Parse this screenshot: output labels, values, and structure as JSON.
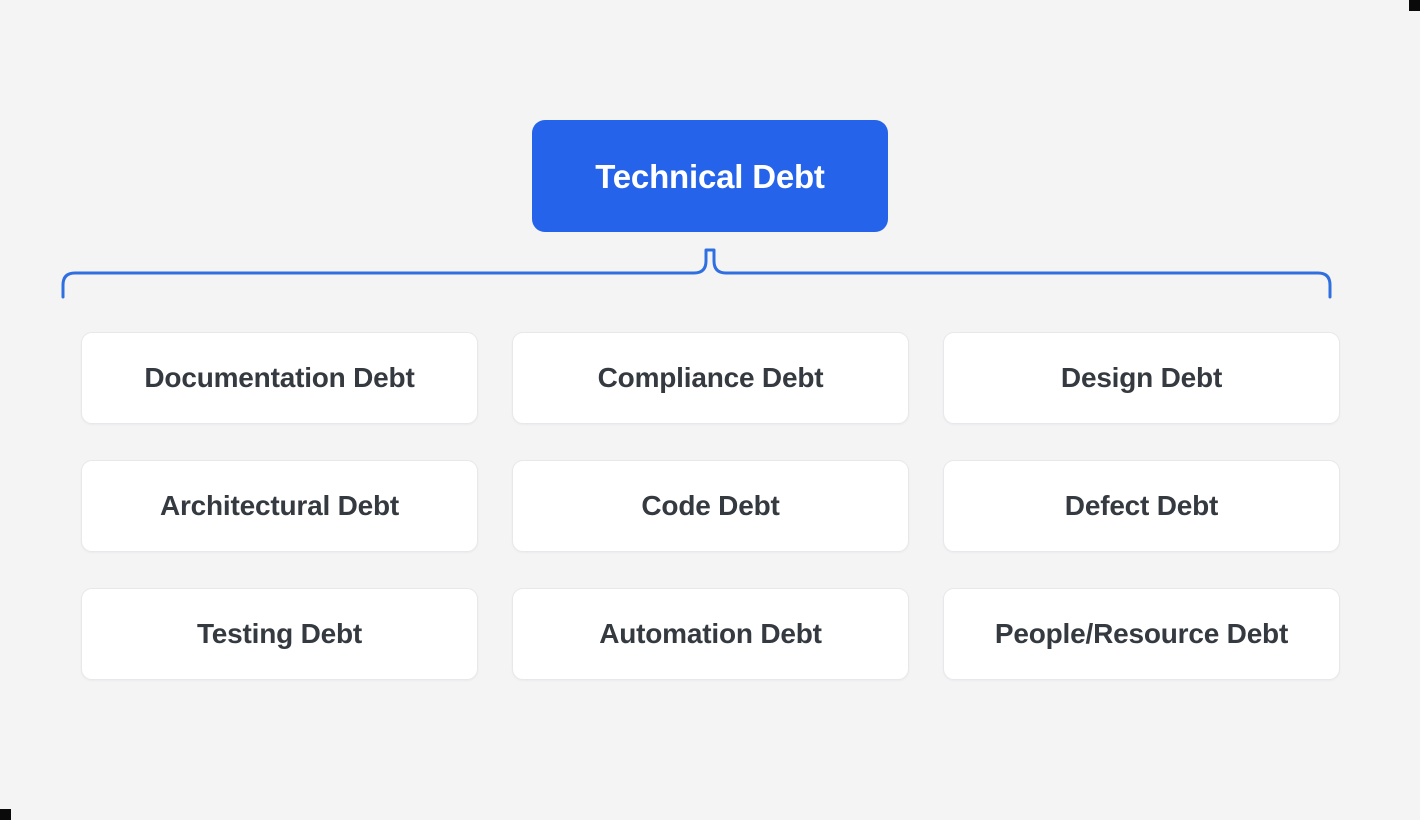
{
  "diagram": {
    "type": "mind-map",
    "title": "Technical Debt",
    "root": {
      "label": "Technical Debt",
      "color": "#2563eb",
      "text_color": "#ffffff"
    },
    "connector": {
      "style": "curly-brace",
      "color": "#2f6fe0",
      "stroke_width": 3
    },
    "background_color": "#f4f4f5",
    "card": {
      "background_color": "#ffffff",
      "border_color": "#e8e8ea",
      "text_color": "#343a40"
    },
    "branches": [
      {
        "label": "Documentation Debt"
      },
      {
        "label": "Compliance Debt"
      },
      {
        "label": "Design Debt"
      },
      {
        "label": "Architectural Debt"
      },
      {
        "label": "Code Debt"
      },
      {
        "label": "Defect Debt"
      },
      {
        "label": "Testing Debt"
      },
      {
        "label": "Automation Debt"
      },
      {
        "label": "People/Resource Debt"
      }
    ]
  }
}
